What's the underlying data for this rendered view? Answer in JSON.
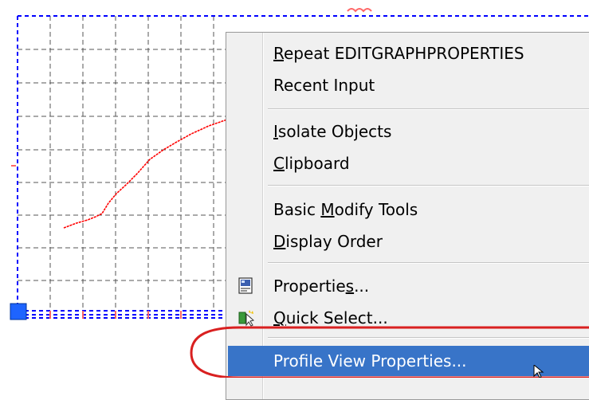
{
  "menu": {
    "items": [
      {
        "id": "repeat",
        "label": "Repeat EDITGRAPHPROPERTIES",
        "ul": 0
      },
      {
        "id": "recent",
        "label": "Recent Input",
        "ul": -1
      },
      {
        "id": "isolate",
        "label": "Isolate Objects",
        "ul": 0
      },
      {
        "id": "clipboard",
        "label": "Clipboard",
        "ul": 0
      },
      {
        "id": "basic-modify",
        "label": "Basic Modify Tools",
        "ul": 6
      },
      {
        "id": "display-order",
        "label": "Display Order",
        "ul": 0
      },
      {
        "id": "properties",
        "label": "Properties...",
        "ul": 9
      },
      {
        "id": "quick-select",
        "label": "Quick Select...",
        "ul": 0
      },
      {
        "id": "profile-view",
        "label": "Profile View Properties...",
        "ul": -1
      }
    ],
    "highlighted_item": "Profile View Properties...",
    "icons": [
      "properties-icon",
      "quick-select-icon"
    ]
  },
  "colors": {
    "grid_border": "#0000ff",
    "grid_lines": "#555555",
    "profile_line": "#ff0000",
    "grip": "#1e64ff",
    "highlight": "#3874c8",
    "annotation_ellipse": "#d92020"
  }
}
